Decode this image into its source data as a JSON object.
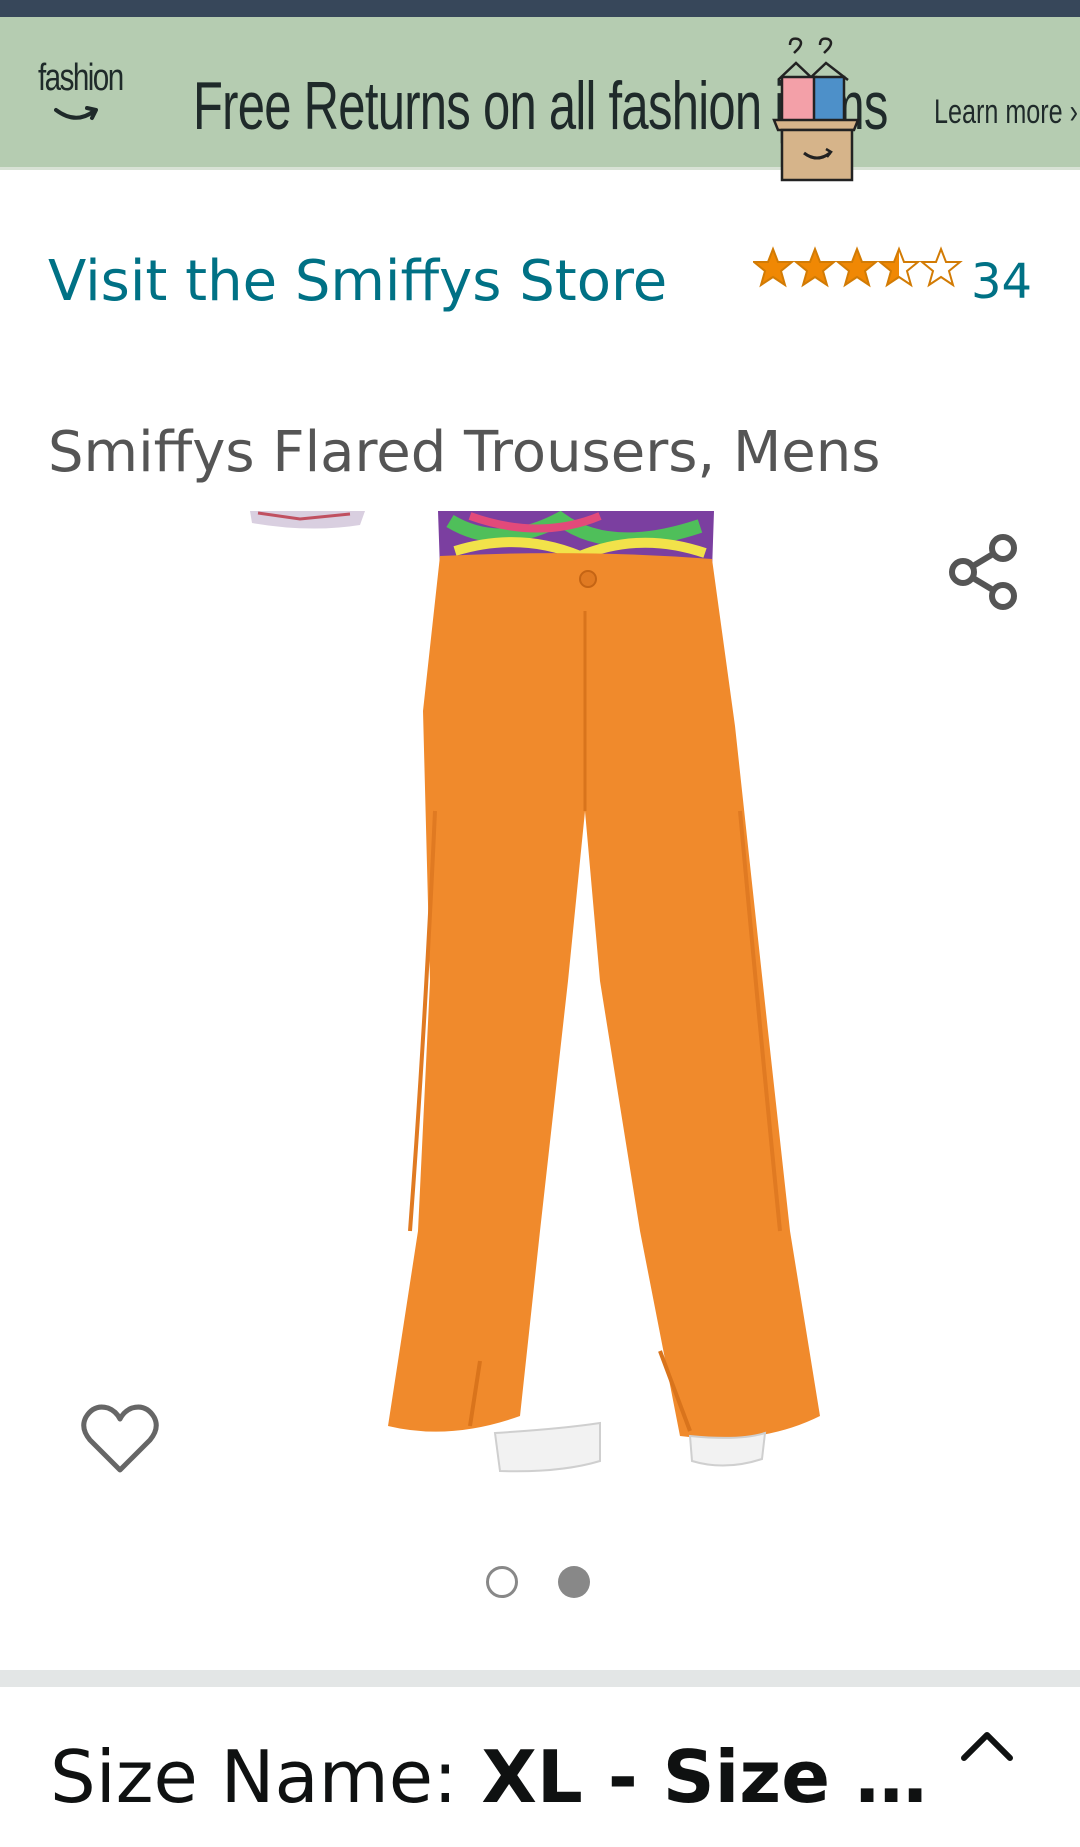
{
  "banner": {
    "logo_text": "fashion",
    "headline": "Free Returns on all fashion items",
    "learn_more": "Learn more ›"
  },
  "product": {
    "store_link": "Visit the Smiffys Store",
    "rating_value": 3.5,
    "rating_count": "34",
    "title": "Smiffys Flared Trousers, Mens",
    "image_description_icon": "orange-flared-trousers-image"
  },
  "carousel": {
    "total": 2,
    "active_index": 1
  },
  "variation": {
    "label": "Size Name:",
    "value": "XL - Size …"
  },
  "colors": {
    "link": "#007185",
    "star": "#f08804",
    "banner_bg": "#b5ccb1",
    "topbar": "#37475a",
    "trousers": "#f08a2c"
  }
}
